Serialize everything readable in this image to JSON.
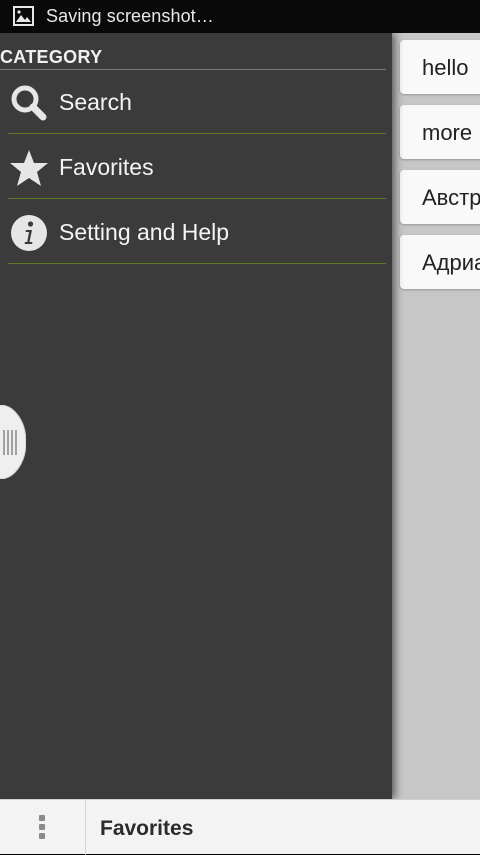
{
  "status_bar": {
    "icon": "image-icon",
    "text": "Saving screenshot…"
  },
  "drawer": {
    "header": "CATEGORY",
    "items": [
      {
        "label": "Search",
        "icon": "search-icon"
      },
      {
        "label": "Favorites",
        "icon": "star-icon"
      },
      {
        "label": "Setting and Help",
        "icon": "info-icon"
      }
    ]
  },
  "content": {
    "cards": [
      {
        "text": "hello"
      },
      {
        "text": "more"
      },
      {
        "text": "Австр"
      },
      {
        "text": "Адриа"
      }
    ]
  },
  "bottom_bar": {
    "overflow_icon": "overflow-menu-icon",
    "title": "Favorites"
  },
  "colors": {
    "drawer_bg": "#3b3b3b",
    "divider_accent": "#5e7a25",
    "content_bg": "#c7c7c7",
    "card_bg": "#f9f9f9"
  }
}
